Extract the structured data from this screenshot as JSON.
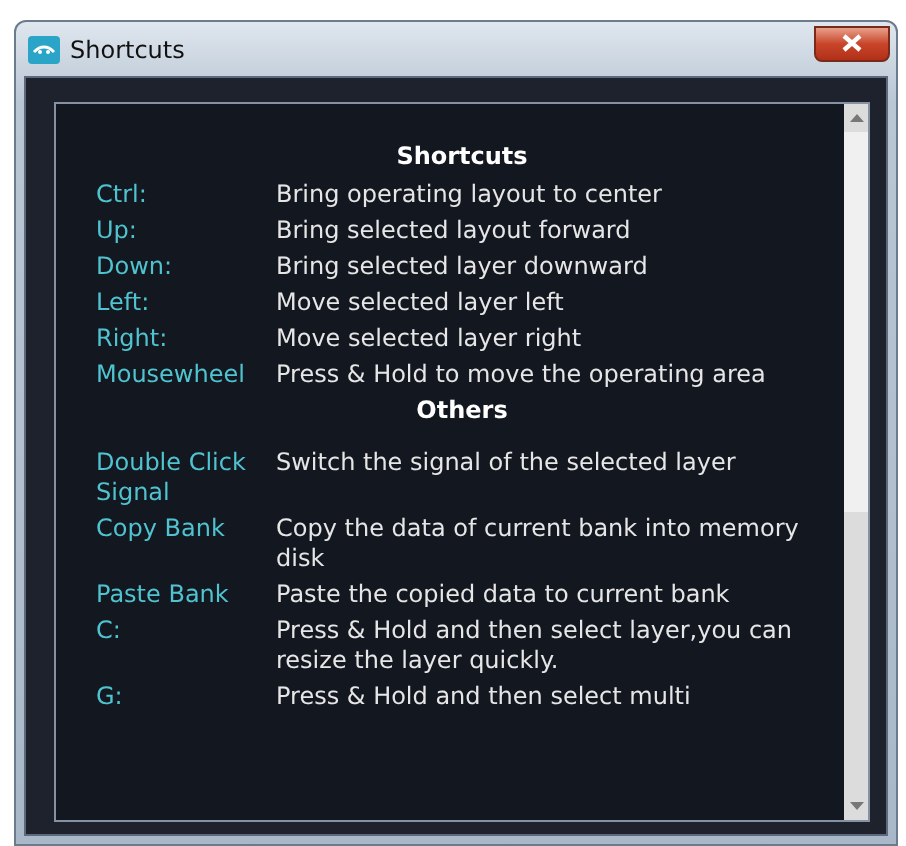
{
  "window": {
    "title": "Shortcuts"
  },
  "sections": [
    {
      "heading": "Shortcuts",
      "rows": [
        {
          "key": "Ctrl:",
          "description": "Bring operating layout to center"
        },
        {
          "key": "Up:",
          "description": "Bring selected layout forward"
        },
        {
          "key": "Down:",
          "description": "Bring selected layer downward"
        },
        {
          "key": "Left:",
          "description": "Move selected layer left"
        },
        {
          "key": "Right:",
          "description": "Move selected layer right"
        },
        {
          "key": "Mousewheel",
          "description": "Press & Hold to move the operating area"
        }
      ]
    },
    {
      "heading": "Others",
      "rows": [
        {
          "key": "Double Click Signal",
          "description": "Switch the signal of the selected layer"
        },
        {
          "key": "Copy Bank",
          "description": "Copy the data of current bank into memory disk"
        },
        {
          "key": "Paste Bank",
          "description": "Paste the copied data to current bank"
        },
        {
          "key": "C:",
          "description": "Press & Hold and then select layer,you can resize the layer quickly."
        },
        {
          "key": "G:",
          "description": "Press & Hold and then select multi"
        }
      ]
    }
  ]
}
